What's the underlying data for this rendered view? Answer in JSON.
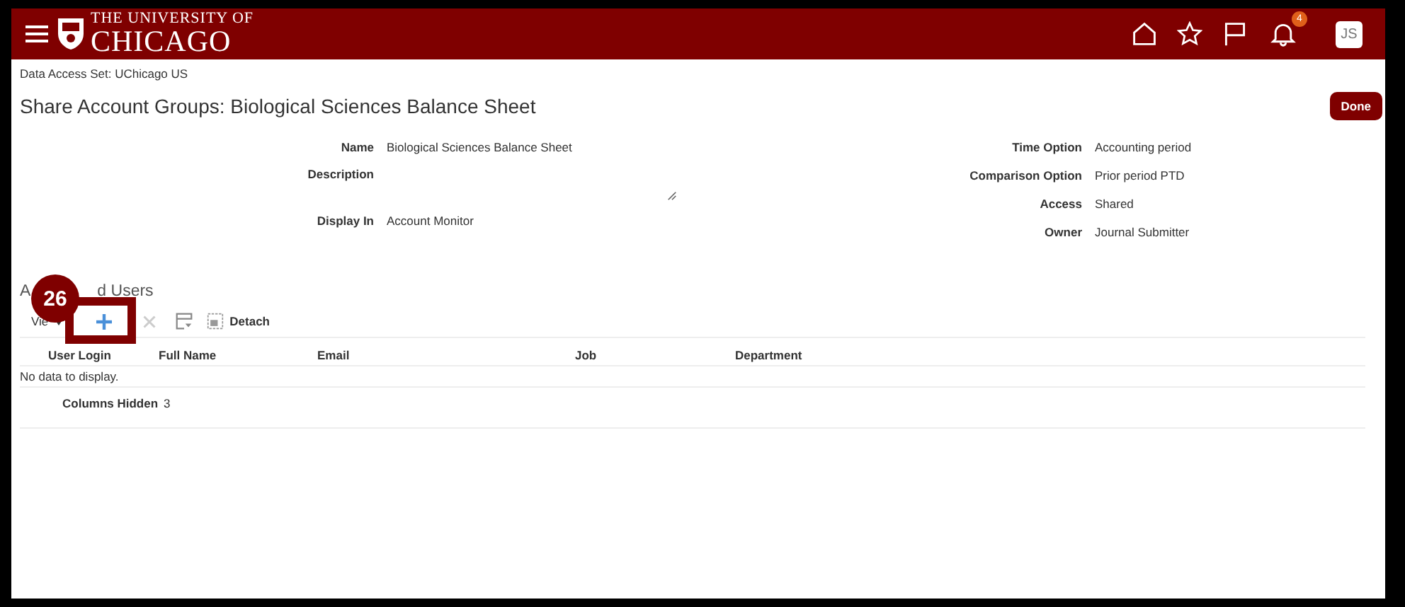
{
  "header": {
    "logo_top": "THE UNIVERSITY OF",
    "logo_bottom": "CHICAGO",
    "notification_count": "4",
    "avatar": "JS"
  },
  "data_access": "Data Access Set: UChicago US",
  "page_title": "Share Account Groups: Biological Sciences Balance Sheet",
  "done_button": "Done",
  "left_fields": [
    {
      "label": "Name",
      "value": "Biological Sciences Balance Sheet"
    },
    {
      "label": "Description",
      "kind": "textarea"
    },
    {
      "label": "Display In",
      "value": "Account Monitor"
    }
  ],
  "right_fields": [
    {
      "label": "Time Option",
      "value": "Accounting period"
    },
    {
      "label": "Comparison Option",
      "value": "Prior period PTD"
    },
    {
      "label": "Access",
      "value": "Shared"
    },
    {
      "label": "Owner",
      "value": "Journal Submitter"
    }
  ],
  "section": {
    "title_start": "A",
    "title_end": "d Users"
  },
  "toolbar": {
    "view": "Vie",
    "detach": "Detach"
  },
  "table": {
    "columns": [
      "User Login",
      "Full Name",
      "Email",
      "Job",
      "Department"
    ],
    "empty_message": "No data to display.",
    "columns_hidden_label": "Columns Hidden",
    "columns_hidden_count": "3"
  },
  "callout": {
    "step": "26"
  }
}
